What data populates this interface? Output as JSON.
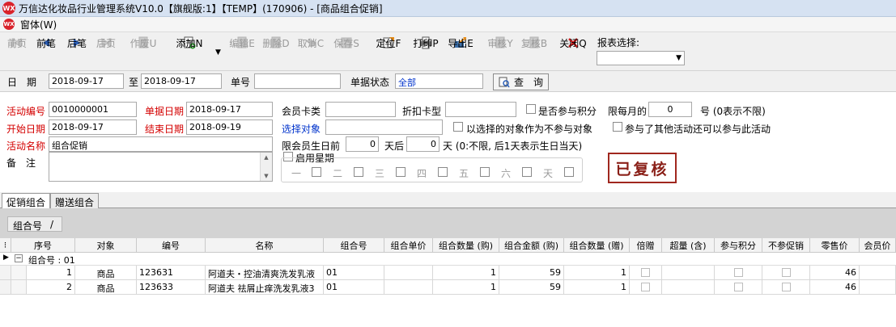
{
  "window": {
    "title": "万信达化妆品行业管理系统V10.0【旗舰版:1】【TEMP】(170906) - [商品组合促销]",
    "logo_text": "WX"
  },
  "menubar": {
    "items": [
      "窗体(W)"
    ]
  },
  "toolbar": {
    "buttons": [
      {
        "label": "前页",
        "icon": "first-page-icon",
        "enabled": false
      },
      {
        "label": "前笔",
        "icon": "prev-record-icon",
        "enabled": true
      },
      {
        "label": "后笔",
        "icon": "next-record-icon",
        "enabled": true
      },
      {
        "label": "后页",
        "icon": "last-page-icon",
        "enabled": false
      },
      {
        "label": "作废U",
        "icon": "void-icon",
        "enabled": false
      },
      {
        "label": "添加N",
        "icon": "add-icon",
        "enabled": true
      },
      {
        "label": "编辑E",
        "icon": "edit-icon",
        "enabled": false
      },
      {
        "label": "删除D",
        "icon": "delete-icon",
        "enabled": false
      },
      {
        "label": "取消C",
        "icon": "undo-icon",
        "enabled": false
      },
      {
        "label": "保存S",
        "icon": "save-icon",
        "enabled": false
      },
      {
        "label": "定位F",
        "icon": "locate-icon",
        "enabled": true
      },
      {
        "label": "打印P",
        "icon": "print-icon",
        "enabled": true
      },
      {
        "label": "导出E",
        "icon": "export-icon",
        "enabled": true
      },
      {
        "label": "审核Y",
        "icon": "approve-icon",
        "enabled": false
      },
      {
        "label": "复核B",
        "icon": "review-icon",
        "enabled": false
      },
      {
        "label": "关闭Q",
        "icon": "close-icon",
        "enabled": true
      }
    ],
    "report_label": "报表选择:",
    "report_value": ""
  },
  "query": {
    "date_label": "日　期",
    "date_from": "2018-09-17",
    "to_label": "至",
    "date_to": "2018-09-17",
    "doc_no_label": "单号",
    "doc_no": "",
    "status_label": "单据状态",
    "status": "全部",
    "search_button": "查　询"
  },
  "form": {
    "activity_no_label": "活动编号",
    "activity_no": "0010000001",
    "doc_date_label": "单据日期",
    "doc_date": "2018-09-17",
    "member_type_label": "会员卡类",
    "member_type": "",
    "discount_type_label": "折扣卡型",
    "discount_type": "",
    "points_label": "是否参与积分",
    "monthly_limit_label": "限每月的",
    "monthly_limit": "0",
    "monthly_limit_suffix": "号 (0表示不限)",
    "start_date_label": "开始日期",
    "start_date": "2018-09-17",
    "end_date_label": "结束日期",
    "end_date": "2018-09-19",
    "select_target_label": "选择对象",
    "select_target": "",
    "exclude_target_label": "以选择的对象作为不参与对象",
    "other_activity_label": "参与了其他活动还可以参与此活动",
    "activity_name_label": "活动名称",
    "activity_name": "组合促销",
    "birthday_label": "限会员生日前",
    "birthday_before": "0",
    "days_after_label": "天后",
    "birthday_after": "0",
    "birthday_suffix": "天 (0:不限, 后1天表示生日当天)",
    "memo_label": "备　注",
    "memo": "",
    "enable_week_label": "启用星期",
    "weekdays": [
      "一",
      "二",
      "三",
      "四",
      "五",
      "六",
      "天"
    ],
    "stamp": "已复核"
  },
  "tabs": [
    "促销组合",
    "赠送组合"
  ],
  "grid": {
    "group_chip_label": "组合号",
    "group_chip_sep": "/",
    "columns": [
      "序号",
      "对象",
      "编号",
      "名称",
      "组合号",
      "组合单价",
      "组合数量 (购)",
      "组合金额 (购)",
      "组合数量 (赠)",
      "倍赠",
      "超量 (含)",
      "参与积分",
      "不参促销",
      "零售价",
      "会员价"
    ],
    "group_row": "组合号 : 01",
    "rows": [
      {
        "seq": "1",
        "type": "商品",
        "code": "123631",
        "name": "阿道夫・控油清爽洗发乳液",
        "group": "01",
        "price": "",
        "qty_buy": "1",
        "amount_buy": "59",
        "qty_gift": "1",
        "retail": "46",
        "member": ""
      },
      {
        "seq": "2",
        "type": "商品",
        "code": "123633",
        "name": "阿道夫 祛屑止痒洗发乳液3",
        "group": "01",
        "price": "",
        "qty_buy": "1",
        "amount_buy": "59",
        "qty_gift": "1",
        "retail": "46",
        "member": ""
      }
    ]
  }
}
